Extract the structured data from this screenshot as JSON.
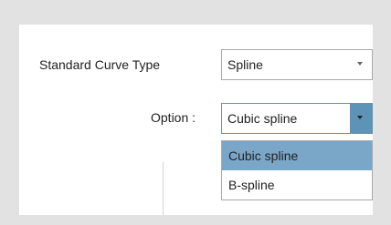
{
  "form": {
    "curve_type_label": "Standard Curve Type",
    "curve_type_value": "Spline",
    "option_label": "Option :",
    "option_value": "Cubic spline"
  },
  "dropdown": {
    "items": [
      {
        "label": "Cubic spline",
        "selected": true
      },
      {
        "label": "B-spline",
        "selected": false
      }
    ]
  },
  "colors": {
    "highlight": "#7aa7c7",
    "arrow_active": "#5e93b8"
  }
}
